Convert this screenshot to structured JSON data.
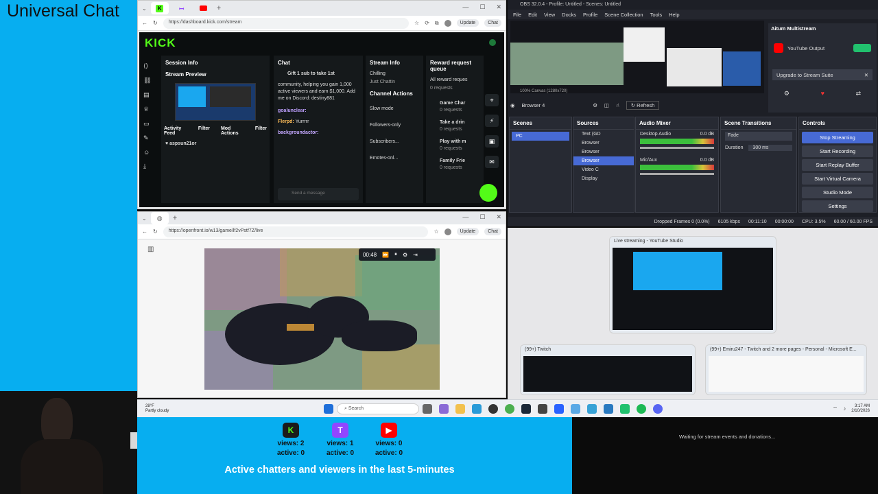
{
  "overlay": {
    "title": "Universal Chat",
    "caption": "Active chatters and viewers in the last 5-minutes",
    "waiting_text": "Waiting for stream events and donations...",
    "platforms": [
      {
        "name": "Kick",
        "icon": "kick-icon",
        "color": "#1b1b1b",
        "views": "views: 2",
        "active": "active: 0"
      },
      {
        "name": "Twitch",
        "icon": "twitch-icon",
        "color": "#9146ff",
        "views": "views: 1",
        "active": "active: 0"
      },
      {
        "name": "YouTube",
        "icon": "youtube-icon",
        "color": "#ff0000",
        "views": "views: 0",
        "active": "active: 0"
      }
    ]
  },
  "browser_top": {
    "url": "https://dashboard.kick.com/stream",
    "update_label": "Update",
    "chat_label": "Chat",
    "kick_logo": "KICK",
    "session_info": "Session Info",
    "stream_preview": "Stream Preview",
    "activity_feed": "Activity Feed",
    "mod_actions": "Mod Actions",
    "filter": "Filter",
    "activity_user": "aspsun21or",
    "chat_title": "Chat",
    "chat_pinned": "Gift 1 sub to take 1st",
    "chat_body": "community, helping you gain 1,000 active viewers and earn $1,000. Add me on Discord: destiny881",
    "chat_msgs": [
      {
        "user": "goalunclear:",
        "text": ""
      },
      {
        "user": "Flerpd:",
        "text": "Yurrrrr"
      },
      {
        "user": "backgroundactor:",
        "text": ""
      }
    ],
    "chat_placeholder": "Send a message",
    "stream_info": "Stream Info",
    "stream_info_value": "Chilling",
    "stream_info_sub": "Just Chattin",
    "channel_actions": "Channel Actions",
    "actions": [
      "Slow mode",
      "Followers-only",
      "Subscribers...",
      "Emotes-onl..."
    ],
    "reward_title": "Reward request queue",
    "all_reward": "All reward reques",
    "all_reward_count": "0 requests",
    "rewards": [
      {
        "name": "Game Char",
        "count": "0 requests"
      },
      {
        "name": "Take a drin",
        "count": "0 requests"
      },
      {
        "name": "Play with m",
        "count": "0 requests"
      },
      {
        "name": "Family Frie",
        "count": "0 requests"
      }
    ]
  },
  "browser_bottom": {
    "url": "https://openfront.io/w13/game/lf2vPstf7Z/live",
    "update_label": "Update",
    "chat_label": "Chat",
    "timer": "00:48"
  },
  "obs": {
    "title": "OBS 32.0.4 - Profile: Untitled - Scenes: Untitled",
    "menu": [
      "File",
      "Edit",
      "View",
      "Docks",
      "Profile",
      "Scene Collection",
      "Tools",
      "Help"
    ],
    "multistream_title": "Aitum Multistream",
    "youtube_output": "YouTube Output",
    "upgrade": "Upgrade to Stream Suite",
    "canvas_label": "100%   Canvas (1280x720)",
    "source_name": "Browser 4",
    "refresh": "Refresh",
    "scenes_title": "Scenes",
    "scenes": [
      "PC"
    ],
    "sources_title": "Sources",
    "sources": [
      "Text (GD",
      "Browser",
      "Browser",
      "Browser",
      "Video C",
      "Display"
    ],
    "audio_title": "Audio Mixer",
    "audio": [
      {
        "name": "Desktop Audio",
        "db": "0.0 dB"
      },
      {
        "name": "Mic/Aux",
        "db": "0.0 dB"
      }
    ],
    "transitions_title": "Scene Transitions",
    "transition": "Fade",
    "duration_label": "Duration",
    "duration_value": "300 ms",
    "controls_title": "Controls",
    "controls": [
      "Stop Streaming",
      "Start Recording",
      "Start Replay Buffer",
      "Start Virtual Camera",
      "Studio Mode",
      "Settings"
    ],
    "status": {
      "dropped": "Dropped Frames 0 (0.0%)",
      "kbps": "6105 kbps",
      "live_time": "00:11:10",
      "rec_time": "00:00:00",
      "cpu": "CPU: 3.5%",
      "fps": "60.00 / 60.00 FPS"
    }
  },
  "desktop": {
    "thumbs": [
      {
        "title": "Live streaming - YouTube Studio"
      },
      {
        "title": "(99+) Twitch"
      },
      {
        "title": "(99+) Emiru247 - Twitch and 2 more pages - Personal - Microsoft E..."
      }
    ]
  },
  "taskbar": {
    "weather_temp": "28°F",
    "weather_desc": "Partly cloudy",
    "search_placeholder": "Search",
    "time": "3:17 AM",
    "date": "2/10/2026"
  }
}
